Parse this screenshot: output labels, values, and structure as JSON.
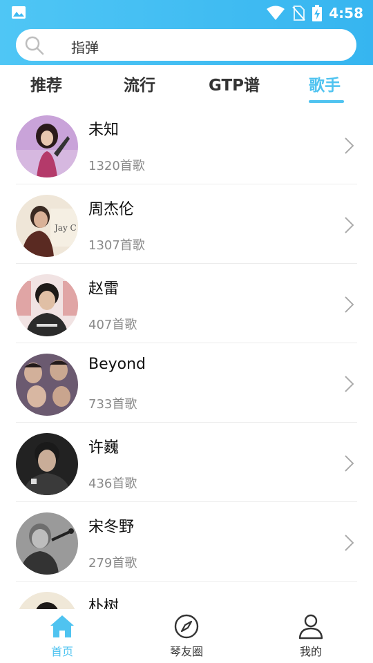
{
  "status_bar": {
    "time": "4:58"
  },
  "search": {
    "value": "指弹"
  },
  "tabs": [
    {
      "label": "推荐",
      "active": false
    },
    {
      "label": "流行",
      "active": false
    },
    {
      "label": "GTP谱",
      "active": false
    },
    {
      "label": "歌手",
      "active": true
    }
  ],
  "artists": [
    {
      "name": "未知",
      "count": "1320首歌"
    },
    {
      "name": "周杰伦",
      "count": "1307首歌"
    },
    {
      "name": "赵雷",
      "count": "407首歌"
    },
    {
      "name": "Beyond",
      "count": "733首歌"
    },
    {
      "name": "许巍",
      "count": "436首歌"
    },
    {
      "name": "宋冬野",
      "count": "279首歌"
    },
    {
      "name": "朴树",
      "count": ""
    }
  ],
  "bottom_nav": [
    {
      "label": "首页",
      "icon": "home-icon",
      "active": true
    },
    {
      "label": "琴友圈",
      "icon": "compass-icon",
      "active": false
    },
    {
      "label": "我的",
      "icon": "person-icon",
      "active": false
    }
  ],
  "colors": {
    "accent": "#4fc3f0",
    "header": "#3db9f2"
  }
}
